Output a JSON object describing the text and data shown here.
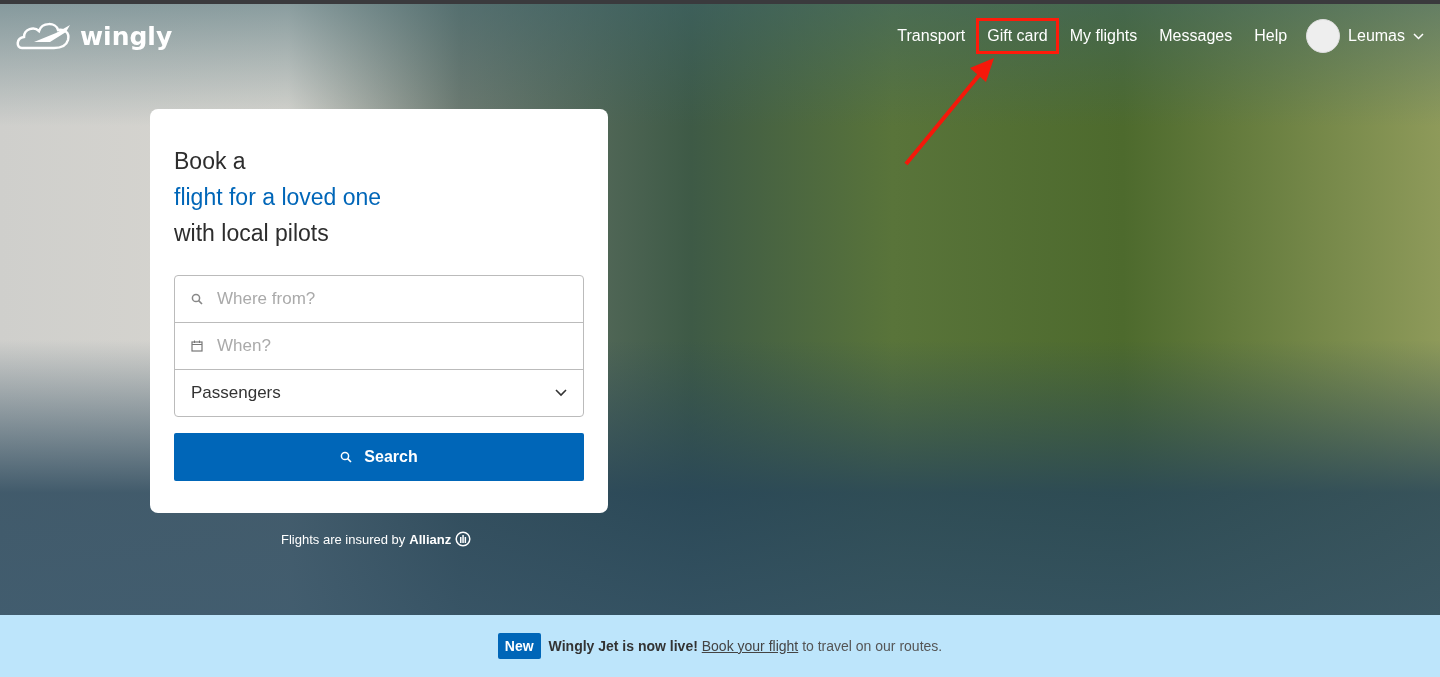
{
  "header": {
    "logo": "wingly",
    "nav": [
      {
        "label": "Transport",
        "highlighted": false
      },
      {
        "label": "Gift card",
        "highlighted": true
      },
      {
        "label": "My flights",
        "highlighted": false
      },
      {
        "label": "Messages",
        "highlighted": false
      },
      {
        "label": "Help",
        "highlighted": false
      }
    ],
    "user": {
      "name": "Leumas"
    }
  },
  "search_card": {
    "title_lines": [
      {
        "text": "Book a",
        "accent": false
      },
      {
        "text": "flight for a loved one",
        "accent": true
      },
      {
        "text": "with local pilots",
        "accent": false
      }
    ],
    "fields": [
      {
        "kind": "place",
        "placeholder": "Where from?"
      },
      {
        "kind": "date",
        "placeholder": "When?"
      },
      {
        "kind": "select",
        "value": "Passengers"
      }
    ],
    "button": "Search"
  },
  "insurance": {
    "text": "Flights are insured by",
    "brand": "Allianz"
  },
  "banner": {
    "badge": "New",
    "lead": "Wingly Jet is now live!",
    "link": "Book your flight",
    "tail": "to travel on our routes."
  }
}
